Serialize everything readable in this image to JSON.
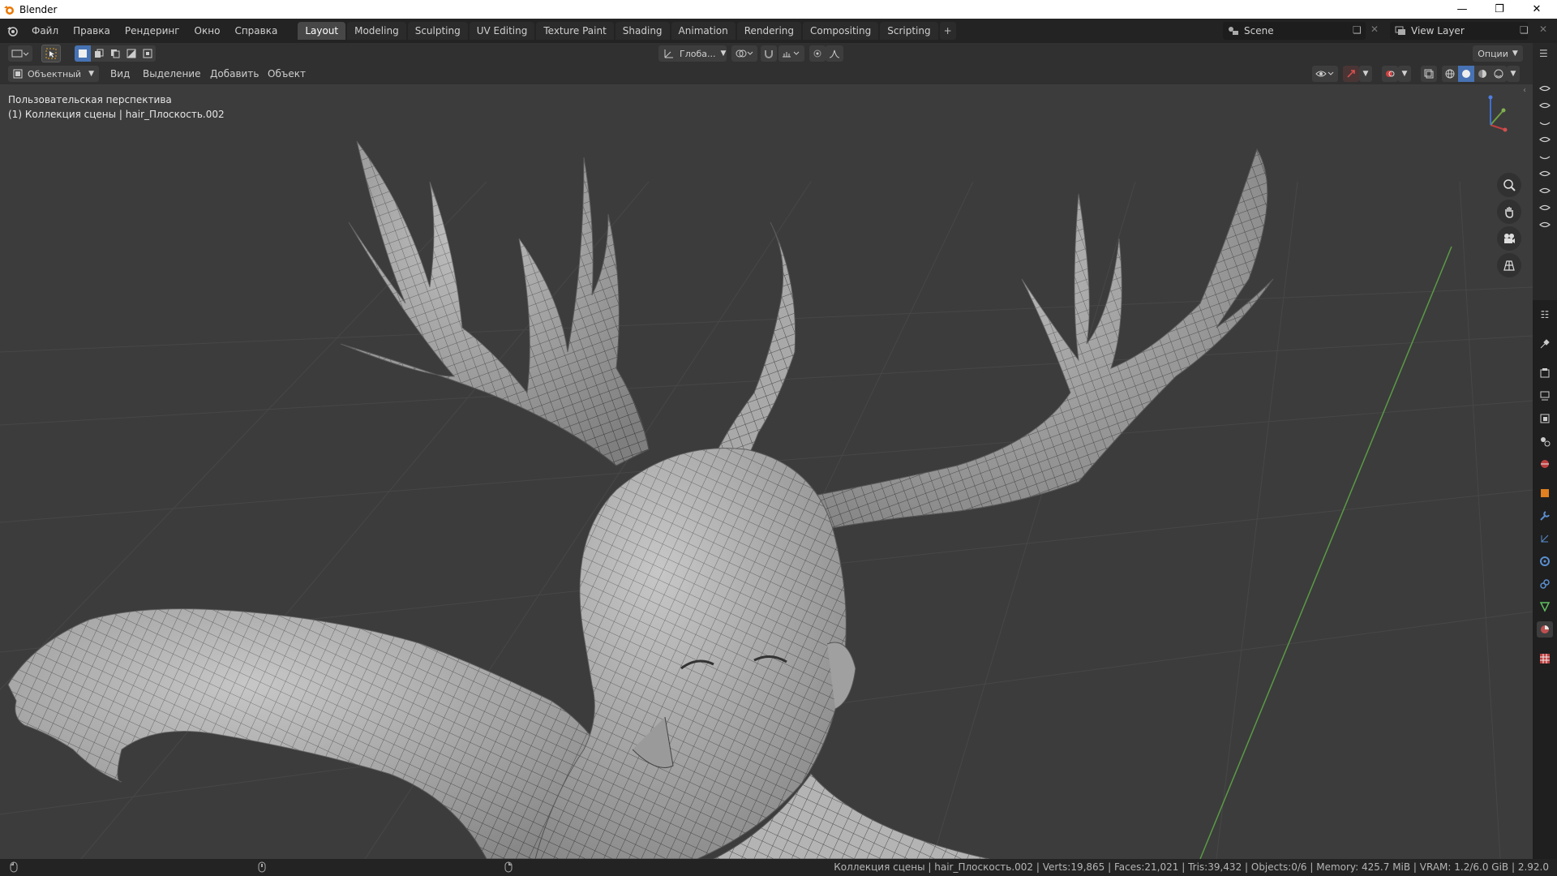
{
  "window": {
    "title": "Blender"
  },
  "menu": {
    "items": [
      "Файл",
      "Правка",
      "Рендеринг",
      "Окно",
      "Справка"
    ]
  },
  "workspaces": {
    "tabs": [
      "Layout",
      "Modeling",
      "Sculpting",
      "UV Editing",
      "Texture Paint",
      "Shading",
      "Animation",
      "Rendering",
      "Compositing",
      "Scripting"
    ],
    "active": "Layout"
  },
  "scene": {
    "name": "Scene",
    "view_layer": "View Layer"
  },
  "header": {
    "transform_orientation": "Глоба...",
    "options_label": "Опции"
  },
  "viewport_header": {
    "mode": "Объектный",
    "menus": [
      "Вид",
      "Выделение",
      "Добавить",
      "Объект"
    ]
  },
  "viewport": {
    "view_name": "Пользовательская перспектива",
    "collection_info": "(1) Коллекция сцены | hair_Плоскость.002"
  },
  "statusbar": {
    "info": "Коллекция сцены | hair_Плоскость.002 | Verts:19,865 | Faces:21,021 | Tris:39,432 | Objects:0/6 | Memory: 425.7 MiB | VRAM: 1.2/6.0 GiB | 2.92.0"
  },
  "colors": {
    "accent": "#4772b3",
    "viewport_bg": "#3c3c3c",
    "header_bg": "#303030",
    "topbar_bg": "#232323"
  }
}
